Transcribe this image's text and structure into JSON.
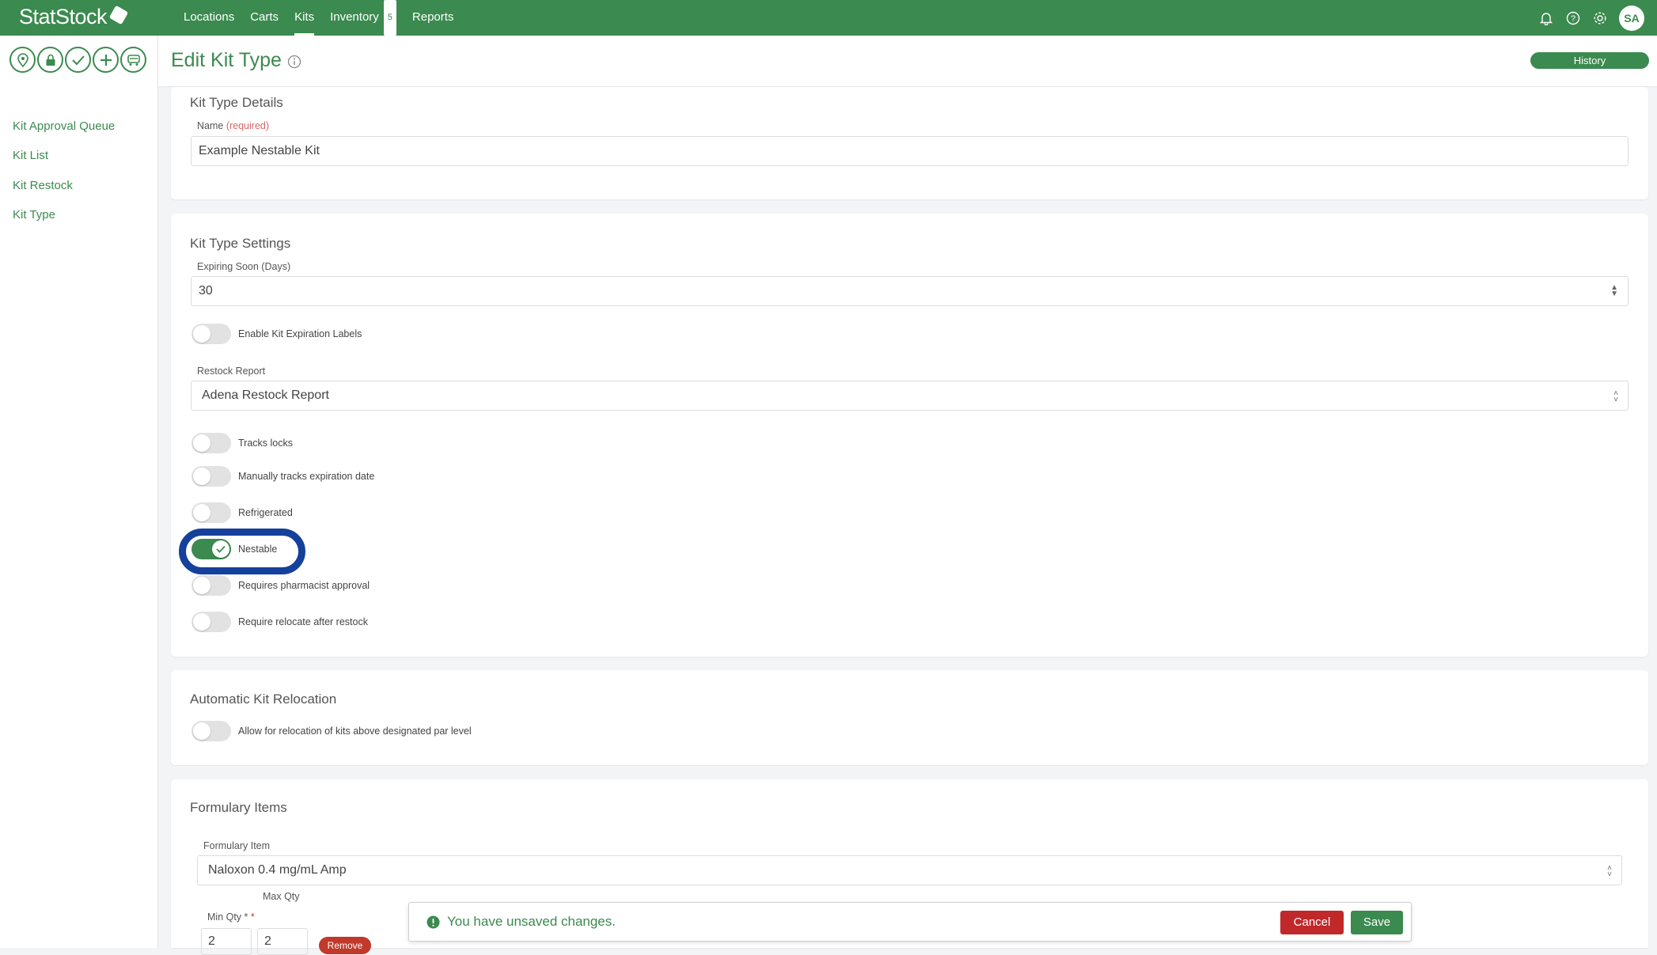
{
  "app": {
    "logo_text": "StatStock"
  },
  "nav": {
    "items": [
      {
        "label": "Locations"
      },
      {
        "label": "Carts"
      },
      {
        "label": "Kits"
      },
      {
        "label": "Inventory",
        "badge": "5"
      },
      {
        "label": "Reports"
      }
    ],
    "active": "Kits"
  },
  "user": {
    "initials": "SA"
  },
  "sidebar": {
    "icons": [
      "location-pin-icon",
      "lock-icon",
      "check-icon",
      "plus-icon",
      "cart-icon"
    ],
    "links": [
      "Kit Approval Queue",
      "Kit List",
      "Kit Restock",
      "Kit Type"
    ]
  },
  "header": {
    "title": "Edit Kit Type",
    "history_label": "History"
  },
  "details": {
    "title": "Kit Type Details",
    "name_label": "Name",
    "name_required": "(required)",
    "name_value": "Example Nestable Kit"
  },
  "settings": {
    "title": "Kit Type Settings",
    "expiring_label": "Expiring Soon (Days)",
    "expiring_value": "30",
    "toggle_expiration_labels": "Enable Kit Expiration Labels",
    "restock_label": "Restock Report",
    "restock_value": "Adena Restock Report",
    "toggles": [
      {
        "label": "Tracks locks",
        "on": false
      },
      {
        "label": "Manually tracks expiration date",
        "on": false
      },
      {
        "label": "Refrigerated",
        "on": false
      },
      {
        "label": "Nestable",
        "on": true
      },
      {
        "label": "Requires pharmacist approval",
        "on": false
      },
      {
        "label": "Require relocate after restock",
        "on": false
      }
    ]
  },
  "relocation": {
    "title": "Automatic Kit Relocation",
    "toggle_label": "Allow for relocation of kits above designated par level"
  },
  "formulary": {
    "title": "Formulary Items",
    "item_label": "Formulary Item",
    "item_value": "Naloxon 0.4 mg/mL Amp",
    "max_label": "Max Qty",
    "min_label": "Min Qty *",
    "min_value": "2",
    "max_value": "2",
    "remove_label": "Remove"
  },
  "unsaved": {
    "message": "You have unsaved changes.",
    "cancel_label": "Cancel",
    "save_label": "Save"
  },
  "colors": {
    "brand": "#3b8a4f",
    "danger": "#c0282a",
    "highlight": "#15409c"
  }
}
